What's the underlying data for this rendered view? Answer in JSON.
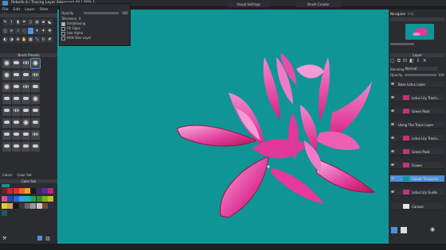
{
  "window": {
    "title": "Rebelle 4 / Tracing Layer Advanced.rbl [ 48% ]"
  },
  "menu": [
    "File",
    "Edit",
    "Layer",
    "Filter",
    "View"
  ],
  "top_tabs": [
    "Info",
    "Visual Settings",
    "Brush Creator"
  ],
  "properties": {
    "header": "Opacity",
    "opacity_value": "100",
    "tolerance_label": "Tolerance",
    "tolerance_value": "0",
    "options": [
      "Antialiasing",
      "Fill Gaps",
      "Use Alpha",
      "Hide Dev Layer"
    ]
  },
  "brush_panel": {
    "title": "Brush Presets"
  },
  "color_panel": {
    "tabs": [
      "Colors",
      "Color Set"
    ],
    "set_name": "Color Set"
  },
  "palette": [
    "#7a1a2c",
    "#c02838",
    "#e0302a",
    "#e86a1a",
    "#f0a020",
    "#1a1a1a",
    "#3a2a6a",
    "#5a2aa0",
    "#c02870",
    "#e04a9a",
    "#2a4aa0",
    "#2a6ad0",
    "#3aa0e0",
    "#20b0c0",
    "#20a060",
    "#3a8a2a",
    "#7ab02a",
    "#c0c02a",
    "#e0d020",
    "#d0a060",
    "#1a1a1a",
    "#3a3a3a",
    "#6a6a6a",
    "#9a9a9a",
    "#cacaca",
    "#7a4a2a",
    "#2a2a5a",
    "#1a5a6a"
  ],
  "navigator": {
    "tabs": [
      "Navigator",
      "Info"
    ]
  },
  "layers_header": "Layer",
  "blending": {
    "label": "Blending",
    "value": "Normal",
    "opacity_label": "Opacity",
    "opacity_value": "100"
  },
  "layers": [
    {
      "name": "Base Lotus Layer",
      "group": true,
      "sel": false
    },
    {
      "name": "Lotus Lily Tracin...",
      "group": false,
      "sel": false
    },
    {
      "name": "Green Pads",
      "group": false,
      "sel": false
    },
    {
      "name": "Using The Trace Layer",
      "group": true,
      "sel": false
    },
    {
      "name": "Lotus Lily Tracin...",
      "group": false,
      "sel": false
    },
    {
      "name": "Green Pads",
      "group": false,
      "sel": false
    },
    {
      "name": "Flower",
      "group": false,
      "sel": false
    },
    {
      "name": "Cobalt Turquoise",
      "group": false,
      "sel": true
    },
    {
      "name": "Lotus Lily Guide",
      "group": false,
      "sel": false
    }
  ],
  "canvas_layer": {
    "name": "Canvas"
  },
  "colors": {
    "accent": "#4a90d9",
    "canvas_bg": "#0f9596",
    "panel": "#2b2c30"
  }
}
